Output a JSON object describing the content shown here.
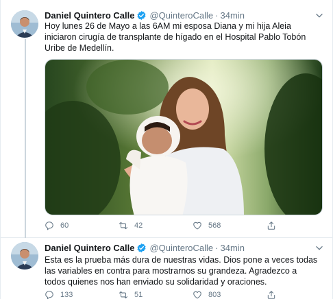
{
  "tweets": [
    {
      "author_name": "Daniel Quintero Calle",
      "handle": "@QuinteroCalle",
      "separator": "·",
      "time": "34min",
      "text": "Hoy lunes 26 de Mayo a las 6AM mi esposa Diana y mi hija Aleia iniciaron cirugía de transplante de hígado en el Hospital Pablo Tobón Uribe de Medellín.",
      "replies": "60",
      "retweets": "42",
      "likes": "568",
      "has_photo": true
    },
    {
      "author_name": "Daniel Quintero Calle",
      "handle": "@QuinteroCalle",
      "separator": "·",
      "time": "34min",
      "text": "Esta es la prueba más dura de nuestras vidas. Dios pone a veces todas las variables en contra para mostrarnos su grandeza. Agradezco a todos quienes nos han enviado su solidaridad y oraciones.",
      "replies": "133",
      "retweets": "51",
      "likes": "803",
      "has_photo": false
    }
  ],
  "icons": {
    "verified": "verified-badge-icon",
    "menu": "chevron-down-icon",
    "reply": "reply-icon",
    "retweet": "retweet-icon",
    "like": "heart-icon",
    "share": "share-icon"
  },
  "colors": {
    "twitter_blue": "#1da1f2",
    "secondary_text": "#657786",
    "thread_line": "#ccd6dd"
  }
}
